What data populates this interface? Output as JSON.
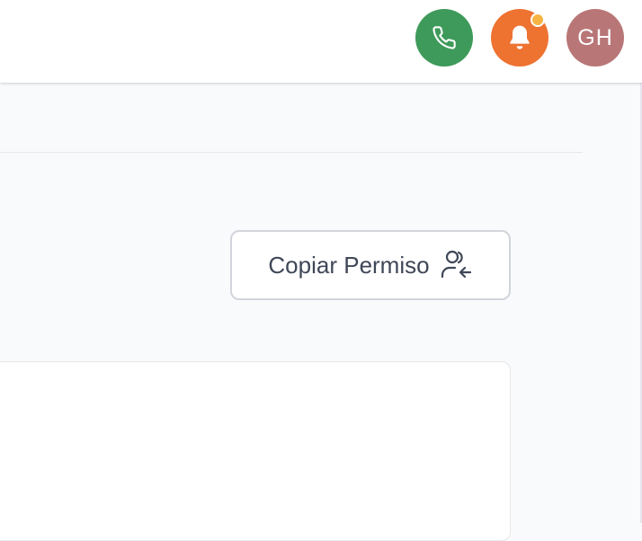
{
  "header": {
    "phone_icon": "phone-icon",
    "bell_icon": "bell-icon",
    "avatar_initials": "GH",
    "colors": {
      "phone": "#3e9a5a",
      "bell": "#ee7230",
      "notification": "#f6b445",
      "avatar": "#b97677"
    }
  },
  "main": {
    "copy_permission_label": "Copiar Permiso",
    "copy_permission_icon": "user-arrow-left-icon"
  }
}
